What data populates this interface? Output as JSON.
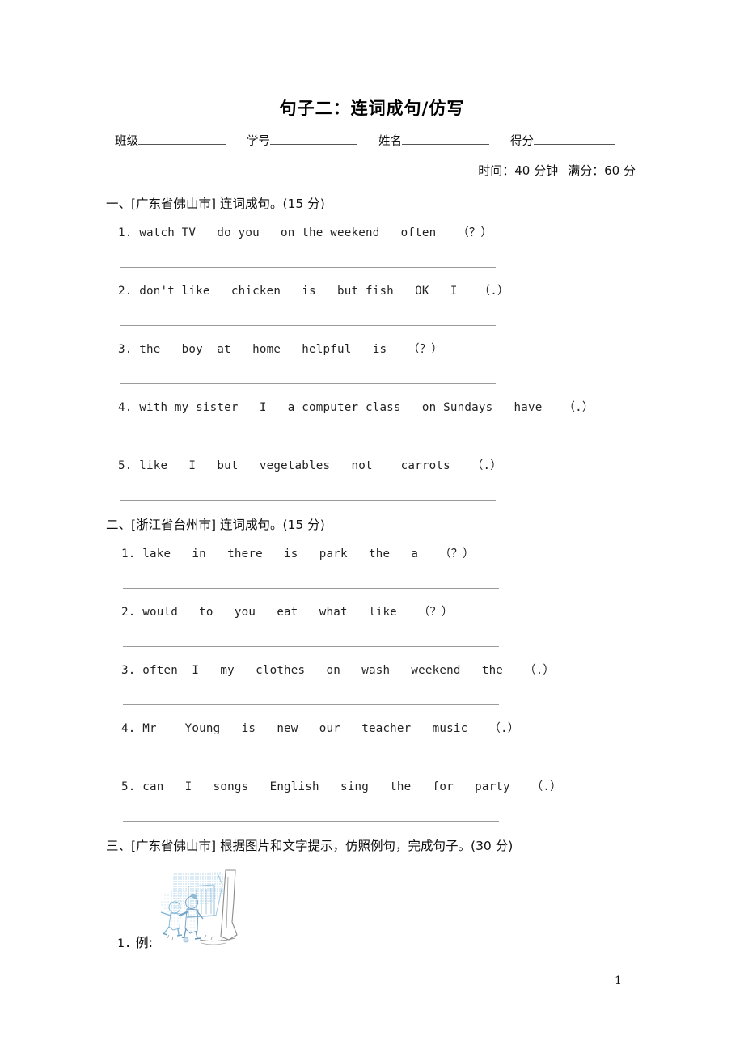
{
  "document": {
    "title": "句子二：连词成句/仿写",
    "page_number": "1"
  },
  "info_fields": {
    "class_label": "班级",
    "student_id_label": "学号",
    "name_label": "姓名",
    "score_label": "得分"
  },
  "meta": {
    "time_label": "时间：",
    "time_value": "40 分钟",
    "total_label": "满分：",
    "total_value": "60 分"
  },
  "sections": [
    {
      "heading": "一、[广东省佛山市] 连词成句。(15 分)",
      "items": [
        "1. watch TV   do you   on the weekend   often   （？）",
        "2. don't like   chicken   is   but fish   OK   I   （.）",
        "3. the   boy  at   home   helpful   is   （？）",
        "4. with my sister   I   a computer class   on Sundays   have   （.）",
        "5. like   I   but   vegetables   not    carrots   （.）"
      ]
    },
    {
      "heading": "二、[浙江省台州市] 连词成句。(15 分)",
      "items": [
        "1. lake   in   there   is   park   the   a   （？）",
        "2. would   to   you   eat   what   like   （？）",
        "3. often  I   my   clothes   on   wash   weekend   the   （.）",
        "4. Mr    Young   is   new   our   teacher   music   （.）",
        "5. can   I   songs   English   sing   the   for   party   （.）"
      ]
    },
    {
      "heading": "三、[广东省佛山市] 根据图片和文字提示，仿照例句，完成句子。(30 分)",
      "illustration_alt": "children-playing-near-tree-illustration",
      "example_number": "1.",
      "example_label": "例:"
    }
  ]
}
